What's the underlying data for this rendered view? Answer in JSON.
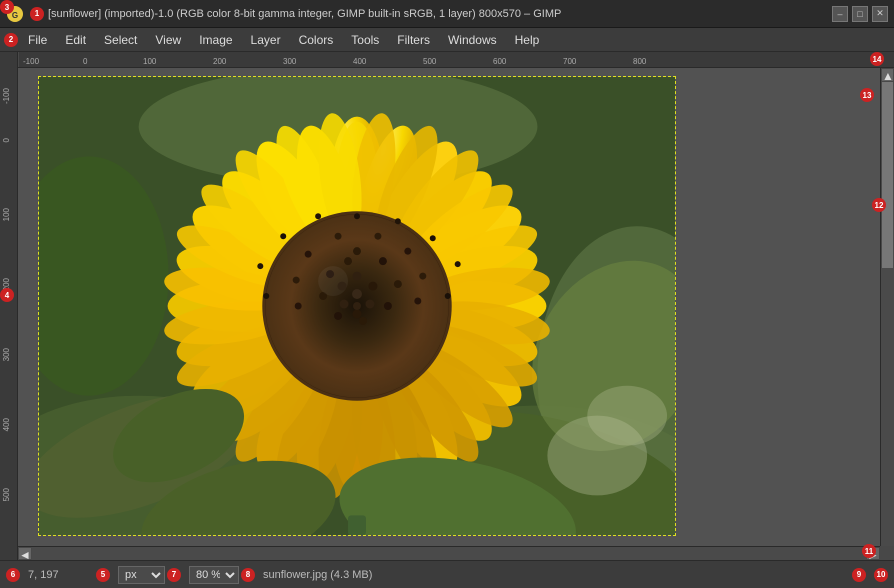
{
  "titlebar": {
    "title": "[sunflower] (imported)-1.0 (RGB color 8-bit gamma integer, GIMP built-in sRGB, 1 layer) 800x570 – GIMP",
    "minimize": "–",
    "maximize": "□",
    "close": "✕"
  },
  "menubar": {
    "items": [
      {
        "label": "File",
        "id": "file"
      },
      {
        "label": "Edit",
        "id": "edit"
      },
      {
        "label": "Select",
        "id": "select"
      },
      {
        "label": "View",
        "id": "view"
      },
      {
        "label": "Image",
        "id": "image"
      },
      {
        "label": "Layer",
        "id": "layer"
      },
      {
        "label": "Colors",
        "id": "colors"
      },
      {
        "label": "Tools",
        "id": "tools"
      },
      {
        "label": "Filters",
        "id": "filters"
      },
      {
        "label": "Windows",
        "id": "windows"
      },
      {
        "label": "Help",
        "id": "help"
      }
    ]
  },
  "statusbar": {
    "coords": "7, 197",
    "unit": "px",
    "zoom": "80 %",
    "filename": "sunflower.jpg (4.3  MB)"
  },
  "badges": [
    {
      "id": 1,
      "num": "1"
    },
    {
      "id": 2,
      "num": "2"
    },
    {
      "id": 3,
      "num": "3"
    },
    {
      "id": 4,
      "num": "4"
    },
    {
      "id": 5,
      "num": "5"
    },
    {
      "id": 6,
      "num": "6"
    },
    {
      "id": 7,
      "num": "7"
    },
    {
      "id": 8,
      "num": "8"
    },
    {
      "id": 9,
      "num": "9"
    },
    {
      "id": 10,
      "num": "10"
    },
    {
      "id": 11,
      "num": "11"
    },
    {
      "id": 12,
      "num": "12"
    },
    {
      "id": 13,
      "num": "13"
    },
    {
      "id": 14,
      "num": "14"
    }
  ]
}
